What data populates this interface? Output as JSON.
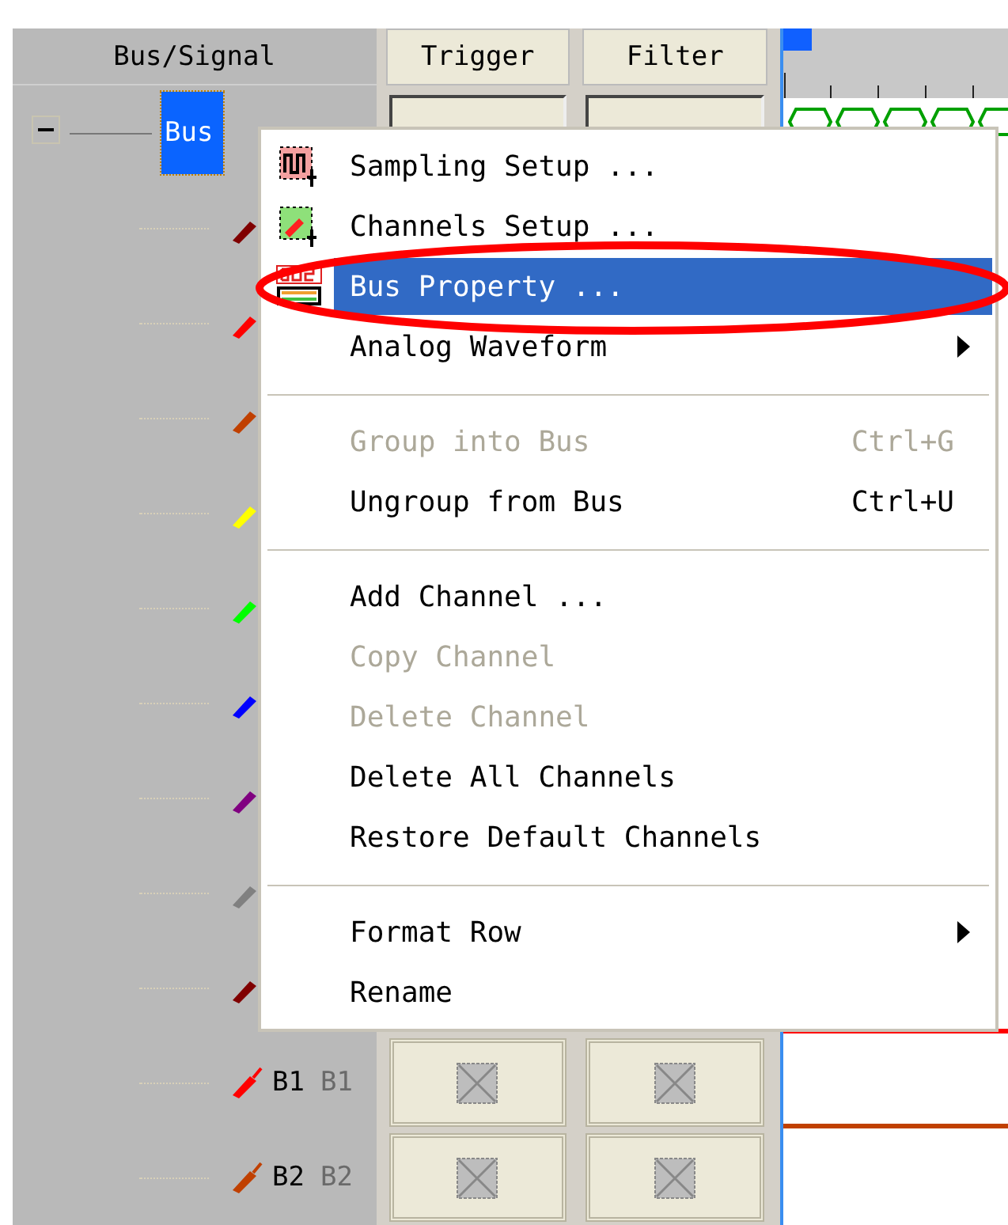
{
  "columns": [
    {
      "label": "Bus/Signal"
    },
    {
      "label": "Trigger"
    },
    {
      "label": "Filter"
    }
  ],
  "bus": {
    "label": "Bus",
    "selected": true,
    "expanded": true
  },
  "channels": [
    {
      "color": "#800000"
    },
    {
      "color": "#ff0000"
    },
    {
      "color": "#c04000"
    },
    {
      "color": "#ffff00"
    },
    {
      "color": "#00ff00"
    },
    {
      "color": "#0000ff"
    },
    {
      "color": "#800080"
    },
    {
      "color": "#808080"
    },
    {
      "color": "#800000"
    },
    {
      "color": "#ff0000",
      "label": "B1",
      "alias": "B1"
    },
    {
      "color": "#c04000",
      "label": "B2",
      "alias": "B2"
    }
  ],
  "menu": [
    {
      "kind": "item",
      "label": "Sampling Setup ...",
      "disabled": false,
      "selected": false
    },
    {
      "kind": "item",
      "label": "Channels Setup ...",
      "disabled": false,
      "selected": false
    },
    {
      "kind": "item",
      "label": "Bus Property ...",
      "disabled": false,
      "selected": true
    },
    {
      "kind": "item",
      "label": "Analog Waveform",
      "disabled": false,
      "selected": false,
      "submenu": true
    },
    {
      "kind": "separator"
    },
    {
      "kind": "item",
      "label": "Group into Bus",
      "shortcut": "Ctrl+G",
      "disabled": true,
      "selected": false
    },
    {
      "kind": "item",
      "label": "Ungroup from Bus",
      "shortcut": "Ctrl+U",
      "disabled": false,
      "selected": false
    },
    {
      "kind": "separator"
    },
    {
      "kind": "item",
      "label": "Add Channel ...",
      "disabled": false,
      "selected": false
    },
    {
      "kind": "item",
      "label": "Copy Channel",
      "disabled": true,
      "selected": false
    },
    {
      "kind": "item",
      "label": "Delete Channel",
      "disabled": true,
      "selected": false
    },
    {
      "kind": "item",
      "label": "Delete All Channels",
      "disabled": false,
      "selected": false
    },
    {
      "kind": "item",
      "label": "Restore Default Channels",
      "disabled": false,
      "selected": false
    },
    {
      "kind": "separator"
    },
    {
      "kind": "item",
      "label": "Format Row",
      "disabled": false,
      "selected": false,
      "submenu": true
    },
    {
      "kind": "item",
      "label": "Rename",
      "disabled": false,
      "selected": false
    }
  ]
}
